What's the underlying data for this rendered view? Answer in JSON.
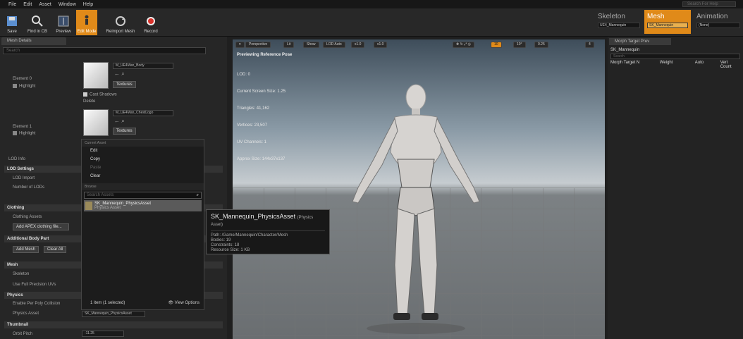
{
  "menu": [
    "File",
    "Edit",
    "Asset",
    "Window",
    "Help"
  ],
  "help_search": {
    "placeholder": "Search For Help"
  },
  "toolbar": [
    {
      "label": "Save",
      "icon": "save-icon"
    },
    {
      "label": "Find in CB",
      "icon": "find-in-content-browser-icon"
    },
    {
      "label": "Preview",
      "icon": "preview-icon"
    },
    {
      "label": "Edit Mode",
      "icon": "edit-mode-icon"
    },
    {
      "label": "Reimport Mesh",
      "icon": "reimport-mesh-icon"
    },
    {
      "label": "Record",
      "icon": "record-icon"
    }
  ],
  "modes": {
    "skeleton": {
      "label": "Skeleton",
      "value": "UE4_Mannequin"
    },
    "mesh": {
      "label": "Mesh",
      "value": "SK_Mannequin"
    },
    "animation": {
      "label": "Animation",
      "value": "(None)"
    }
  },
  "left": {
    "tab": "Mesh Details",
    "search_placeholder": "Search",
    "element0": {
      "label": "Element 0",
      "highlight": "Highlight",
      "material": "M_UE4Man_Body",
      "textures": "Textures",
      "cast_shadows": "Cast Shadows",
      "delete": "Delete"
    },
    "element1": {
      "label": "Element 1",
      "highlight": "Highlight",
      "material": "M_UE4Man_ChestLogo",
      "textures": "Textures"
    },
    "lod_info": "LOD Info",
    "lod_settings": {
      "header": "LOD Settings",
      "lod_import": "LOD Import",
      "num_lods": "Number of LODs"
    },
    "clothing": {
      "header": "Clothing",
      "assets": "Clothing Assets",
      "add_button": "Add APEX clothing file..."
    },
    "body_part": {
      "header": "Additional Body Part",
      "add_mesh": "Add Mesh",
      "clear_all": "Clear All"
    },
    "mesh": {
      "header": "Mesh",
      "skeleton": "Skeleton",
      "full_precision": "Use Full Precision UVs"
    },
    "physics": {
      "header": "Physics",
      "per_poly": "Enable Per Poly Collision",
      "physics_asset": "Physics Asset",
      "physics_value": "SK_Mannequin_PhysicsAsset"
    },
    "thumbnail": {
      "header": "Thumbnail",
      "orbit": "Orbit Pitch",
      "orbit_value": "-11.25"
    }
  },
  "context_menu": {
    "current_asset": "Current Asset",
    "items": [
      "Edit",
      "Copy",
      "Paste",
      "Clear"
    ],
    "browse": "Browse",
    "search_placeholder": "Search Assets",
    "asset_name": "SK_Mannequin_PhysicsAsset",
    "asset_type": "Physics Asset",
    "footer_count": "1 item (1 selected)",
    "view_options": "View Options"
  },
  "viewport": {
    "perspective": "Perspective",
    "lit": "Lit",
    "show": "Show",
    "lod": "LOD Auto",
    "speed1": "x1.0",
    "speed2": "x1.0",
    "snap_angle": "10°",
    "scale": "0.25",
    "camera_speed": "4",
    "grid_value": "10",
    "preview_label": "Previewing Reference Pose",
    "stats": [
      "LOD: 0",
      "Current Screen Size: 1.25",
      "Triangles: 41,162",
      "Vertices: 23,507",
      "UV Channels: 1",
      "Approx Size: 144x37x137"
    ]
  },
  "tooltip": {
    "title": "SK_Mannequin_PhysicsAsset",
    "type": "(Physics Asset)",
    "path": "Path: /Game/Mannequin/Character/Mesh",
    "bodies": "Bodies: 19",
    "constraints": "Constraints: 18",
    "resource_size": "Resource Size: 1 KB"
  },
  "right": {
    "tab": "Morph Target Prev",
    "mesh": "SK_Mannequin",
    "search": "Search",
    "cols": [
      "Morph Target N",
      "Weight",
      "Auto",
      "Vert Count"
    ]
  }
}
